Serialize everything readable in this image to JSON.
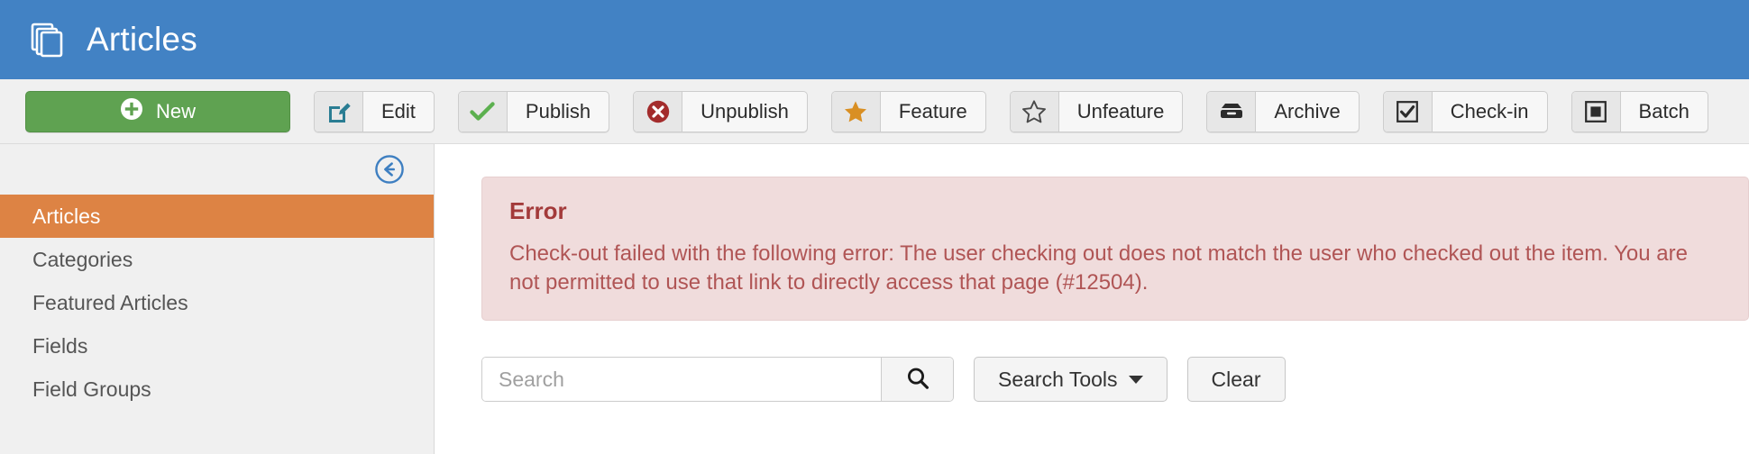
{
  "header": {
    "title": "Articles",
    "icon": "stacked-documents-icon",
    "background_color": "#4282c4"
  },
  "toolbar": {
    "buttons": [
      {
        "label": "New",
        "icon": "plus-circle-icon",
        "style": "primary-green",
        "color": "#5fa251"
      },
      {
        "label": "Edit",
        "icon": "pencil-square-icon",
        "style": "default"
      },
      {
        "label": "Publish",
        "icon": "check-icon",
        "style": "default"
      },
      {
        "label": "Unpublish",
        "icon": "times-circle-icon",
        "style": "default"
      },
      {
        "label": "Feature",
        "icon": "star-filled-icon",
        "style": "default"
      },
      {
        "label": "Unfeature",
        "icon": "star-outline-icon",
        "style": "default"
      },
      {
        "label": "Archive",
        "icon": "archive-box-icon",
        "style": "default"
      },
      {
        "label": "Check-in",
        "icon": "checkbox-checked-icon",
        "style": "default"
      },
      {
        "label": "Batch",
        "icon": "batch-square-icon",
        "style": "default"
      }
    ]
  },
  "sidebar": {
    "collapse_icon": "arrow-circle-left-icon",
    "active_color": "#dd8344",
    "items": [
      {
        "label": "Articles",
        "active": true
      },
      {
        "label": "Categories",
        "active": false
      },
      {
        "label": "Featured Articles",
        "active": false
      },
      {
        "label": "Fields",
        "active": false
      },
      {
        "label": "Field Groups",
        "active": false
      }
    ]
  },
  "main": {
    "alert": {
      "title": "Error",
      "message": "Check-out failed with the following error: The user checking out does not match the user who checked out the item. You are not permitted to use that link to directly access that page (#12504).",
      "text_color": "#a94442",
      "background_color": "#f0dcdc"
    },
    "search": {
      "value": "",
      "placeholder": "Search",
      "submit_icon": "magnifier-icon",
      "tools_label": "Search Tools",
      "clear_label": "Clear"
    }
  }
}
